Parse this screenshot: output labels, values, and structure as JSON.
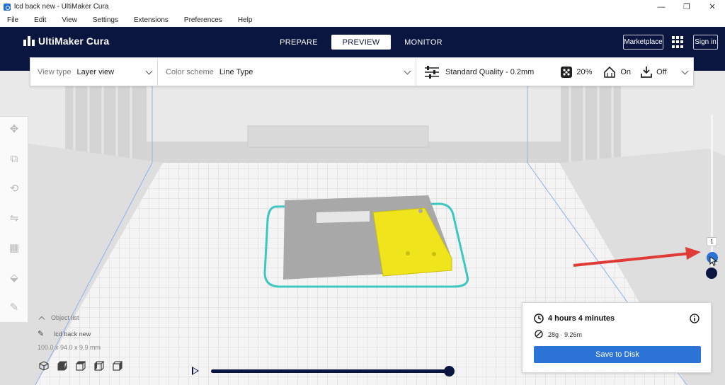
{
  "window": {
    "title": "lcd back new - UltiMaker Cura",
    "minimize": "—",
    "maximize": "❐",
    "close": "✕"
  },
  "menu": [
    "File",
    "Edit",
    "View",
    "Settings",
    "Extensions",
    "Preferences",
    "Help"
  ],
  "header": {
    "logo": "UltiMaker Cura",
    "tabs": [
      {
        "label": "PREPARE",
        "active": false
      },
      {
        "label": "PREVIEW",
        "active": true
      },
      {
        "label": "MONITOR",
        "active": false
      }
    ],
    "marketplace": "Marketplace",
    "sign_in": "Sign in"
  },
  "toolbar": {
    "view_type_label": "View type",
    "view_type_value": "Layer view",
    "color_scheme_label": "Color scheme",
    "color_scheme_value": "Line Type",
    "quality": "Standard Quality - 0.2mm",
    "infill": "20%",
    "support": "On",
    "adhesion": "Off"
  },
  "object_list": {
    "title": "Object list",
    "object_name": "lcd back new",
    "dimensions": "100.0 x 94.0 x 9.9 mm"
  },
  "layer_slider": {
    "current_layer": "1"
  },
  "print_info": {
    "time": "4 hours 4 minutes",
    "material": "28g · 9.26m",
    "save_button": "Save to Disk"
  },
  "colors": {
    "header_bg": "#0a1540",
    "accent": "#2c73d6",
    "model_grey": "#a8a8a8",
    "model_yellow": "#f0e41c",
    "skirt": "#3cc7c0",
    "arrow": "#e03b36"
  }
}
